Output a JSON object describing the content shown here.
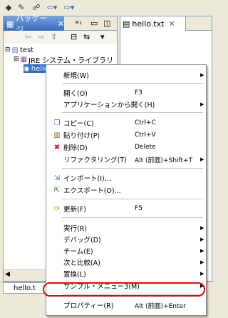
{
  "toolbar": {
    "buttons": [
      "back-icon",
      "forward-icon"
    ]
  },
  "package_explorer": {
    "tab_label": "パッケージ...",
    "tree": [
      {
        "label": "test"
      },
      {
        "label": "JRE システム・ライブラリ"
      },
      {
        "label": "hello.txt"
      }
    ]
  },
  "editor": {
    "tab_label": "hello.txt"
  },
  "status": {
    "tab_label": "hello.t"
  },
  "context_menu": {
    "items": [
      {
        "label": "新規(W)",
        "accel": "",
        "submenu": true,
        "icon": ""
      },
      {
        "label": "開く(O)",
        "accel": "F3",
        "submenu": false,
        "icon": ""
      },
      {
        "label": "アプリケーションから開く(H)",
        "accel": "",
        "submenu": true,
        "icon": ""
      },
      {
        "label": "コピー(C)",
        "accel": "Ctrl+C",
        "submenu": false,
        "icon": "copy-icon"
      },
      {
        "label": "貼り付け(P)",
        "accel": "Ctrl+V",
        "submenu": false,
        "icon": "paste-icon"
      },
      {
        "label": "削除(D)",
        "accel": "Delete",
        "submenu": false,
        "icon": "delete-icon"
      },
      {
        "label": "リファクタリング(T)",
        "accel": "Alt (前面)+Shift+T",
        "submenu": true,
        "icon": ""
      },
      {
        "label": "インポート(I)...",
        "accel": "",
        "submenu": false,
        "icon": "import-icon"
      },
      {
        "label": "エクスポート(O)...",
        "accel": "",
        "submenu": false,
        "icon": "export-icon"
      },
      {
        "label": "更新(F)",
        "accel": "F5",
        "submenu": false,
        "icon": "refresh-icon"
      },
      {
        "label": "実行(R)",
        "accel": "",
        "submenu": true,
        "icon": ""
      },
      {
        "label": "デバッグ(D)",
        "accel": "",
        "submenu": true,
        "icon": ""
      },
      {
        "label": "チーム(E)",
        "accel": "",
        "submenu": true,
        "icon": ""
      },
      {
        "label": "次と比較(A)",
        "accel": "",
        "submenu": true,
        "icon": ""
      },
      {
        "label": "置換(L)",
        "accel": "",
        "submenu": true,
        "icon": ""
      },
      {
        "label": "サンプル・メニュー3(M)",
        "accel": "",
        "submenu": true,
        "icon": ""
      },
      {
        "label": "プロパティー(R)",
        "accel": "Alt (前面)+Enter",
        "submenu": false,
        "icon": ""
      }
    ]
  }
}
